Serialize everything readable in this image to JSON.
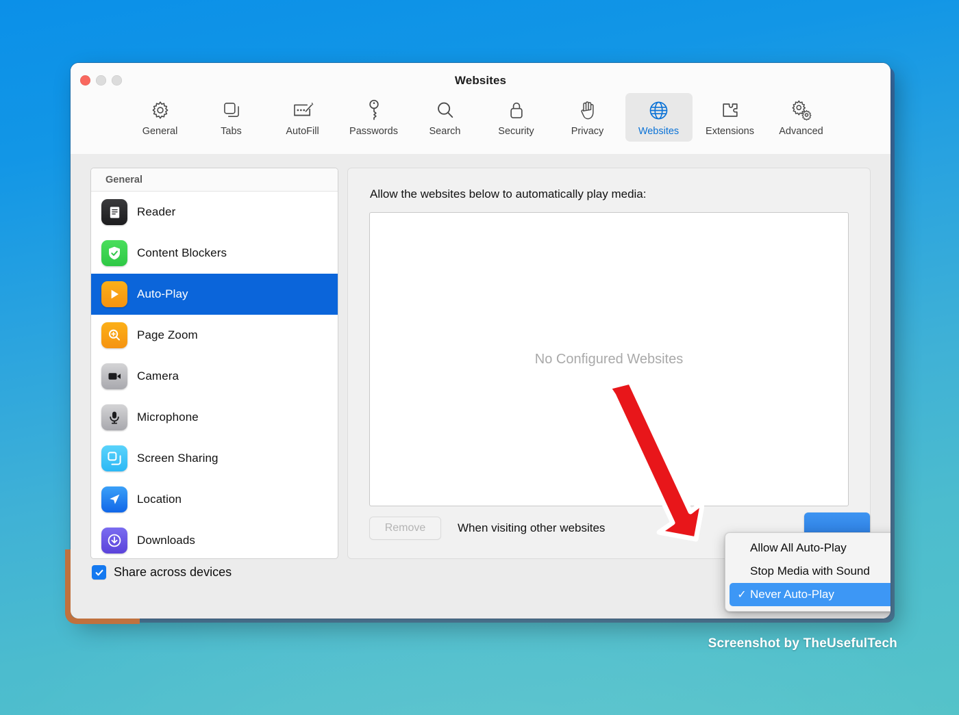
{
  "window": {
    "title": "Websites",
    "traffic_lights": [
      "close",
      "minimize",
      "zoom"
    ]
  },
  "toolbar": {
    "items": [
      {
        "label": "General",
        "icon": "gear-icon",
        "active": false
      },
      {
        "label": "Tabs",
        "icon": "tabs-icon",
        "active": false
      },
      {
        "label": "AutoFill",
        "icon": "autofill-icon",
        "active": false
      },
      {
        "label": "Passwords",
        "icon": "key-icon",
        "active": false
      },
      {
        "label": "Search",
        "icon": "search-icon",
        "active": false
      },
      {
        "label": "Security",
        "icon": "lock-icon",
        "active": false
      },
      {
        "label": "Privacy",
        "icon": "hand-icon",
        "active": false
      },
      {
        "label": "Websites",
        "icon": "globe-icon",
        "active": true
      },
      {
        "label": "Extensions",
        "icon": "puzzle-icon",
        "active": false
      },
      {
        "label": "Advanced",
        "icon": "gears-icon",
        "active": false
      }
    ]
  },
  "sidebar": {
    "header": "General",
    "items": [
      {
        "label": "Reader",
        "icon": "reader-icon",
        "selected": false
      },
      {
        "label": "Content Blockers",
        "icon": "shield-check-icon",
        "selected": false
      },
      {
        "label": "Auto-Play",
        "icon": "play-icon",
        "selected": true
      },
      {
        "label": "Page Zoom",
        "icon": "magnifier-plus-icon",
        "selected": false
      },
      {
        "label": "Camera",
        "icon": "camera-icon",
        "selected": false
      },
      {
        "label": "Microphone",
        "icon": "microphone-icon",
        "selected": false
      },
      {
        "label": "Screen Sharing",
        "icon": "screen-share-icon",
        "selected": false
      },
      {
        "label": "Location",
        "icon": "location-arrow-icon",
        "selected": false
      },
      {
        "label": "Downloads",
        "icon": "download-icon",
        "selected": false
      }
    ]
  },
  "detail": {
    "title": "Allow the websites below to automatically play media:",
    "empty_state": "No Configured Websites",
    "remove_label": "Remove",
    "visiting_label": "When visiting other websites"
  },
  "dropdown": {
    "options": [
      {
        "label": "Allow All Auto-Play",
        "checked": false
      },
      {
        "label": "Stop Media with Sound",
        "checked": false
      },
      {
        "label": "Never Auto-Play",
        "checked": true
      }
    ],
    "checkmark": "✓"
  },
  "bottom": {
    "share_label": "Share across devices",
    "share_checked": true,
    "checkmark": "✓",
    "help_label": "?"
  },
  "annotation": {
    "arrow": "red-down-right-arrow"
  },
  "watermark": "Screenshot by TheUsefulTech",
  "colors": {
    "accent_blue": "#0a72d6",
    "selection_blue": "#0b65da",
    "menu_highlight": "#3d97f5",
    "arrow_red": "#e8161a",
    "desktop_top": "#0b90e8",
    "desktop_bottom": "#55c3c9"
  }
}
